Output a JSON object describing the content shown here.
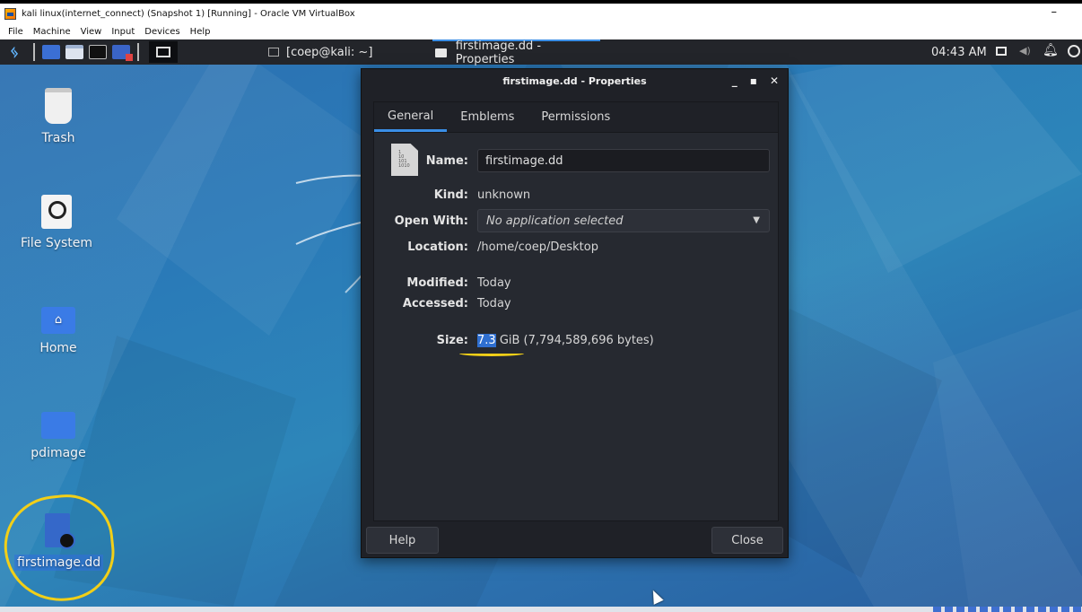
{
  "host": {
    "title": "kali linux(internet_connect) (Snapshot 1) [Running] - Oracle VM VirtualBox",
    "minimize": "–",
    "menu": [
      "File",
      "Machine",
      "View",
      "Input",
      "Devices",
      "Help"
    ]
  },
  "panel": {
    "tasks": {
      "terminal": "[coep@kali: ~]",
      "properties": "firstimage.dd - Properties"
    },
    "clock": "04:43 AM"
  },
  "desktop_icons": [
    {
      "label": "Trash",
      "icon": "trash-icon"
    },
    {
      "label": "File System",
      "icon": "drive-icon"
    },
    {
      "label": "Home",
      "icon": "home-folder-icon"
    },
    {
      "label": "pdimage",
      "icon": "folder-icon"
    },
    {
      "label": "firstimage.dd",
      "icon": "locked-file-icon"
    }
  ],
  "dialog": {
    "title": "firstimage.dd - Properties",
    "tabs": [
      "General",
      "Emblems",
      "Permissions"
    ],
    "active_tab": "General",
    "labels": {
      "name": "Name:",
      "kind": "Kind:",
      "open_with": "Open With:",
      "location": "Location:",
      "modified": "Modified:",
      "accessed": "Accessed:",
      "size": "Size:"
    },
    "values": {
      "name": "firstimage.dd",
      "kind": "unknown",
      "open_with": "No application selected",
      "location": "/home/coep/Desktop",
      "modified": "Today",
      "accessed": "Today",
      "size_selected": "7.3",
      "size_rest": " GiB (7,794,589,696 bytes)"
    },
    "file_glyph": "1\n10\n101\n1010",
    "buttons": {
      "help": "Help",
      "close": "Close"
    }
  },
  "colors": {
    "accent": "#3a8ee6",
    "annotation": "#f2cf18",
    "dialog_bg": "#1f2127"
  }
}
